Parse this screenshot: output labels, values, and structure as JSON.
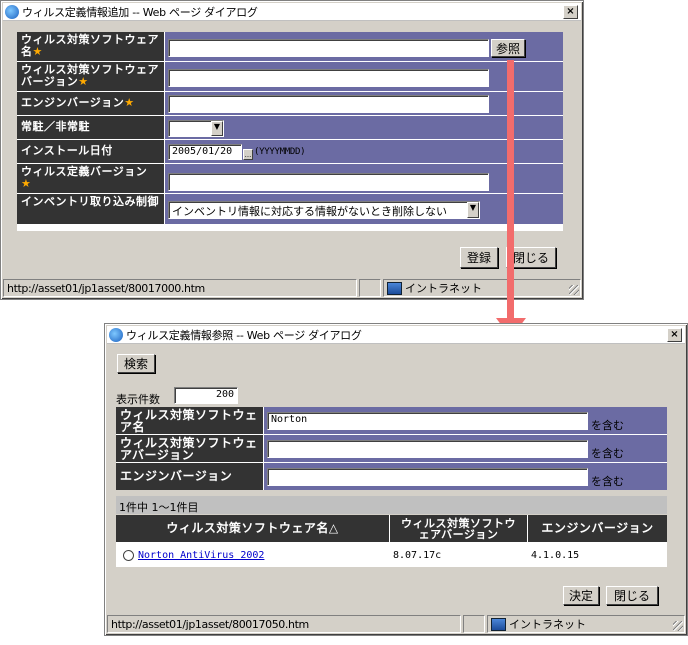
{
  "dialog1": {
    "title": "ウィルス定義情報追加 -- Web ページ ダイアログ",
    "close": "×",
    "fields": [
      {
        "label": "ウィルス対策ソフトウェア名",
        "required": true,
        "type": "text",
        "value": ""
      },
      {
        "label": "ウィルス対策ソフトウェアバージョン",
        "required": true,
        "type": "text",
        "value": ""
      },
      {
        "label": "エンジンバージョン",
        "required": true,
        "type": "text",
        "value": ""
      },
      {
        "label": "常駐／非常駐",
        "required": false,
        "type": "select",
        "value": ""
      },
      {
        "label": "インストール日付",
        "required": false,
        "type": "date",
        "value": "2005/01/20",
        "format": "(YYYYMMDD)"
      },
      {
        "label": "ウィルス定義バージョン",
        "required": true,
        "type": "text",
        "value": ""
      },
      {
        "label": "インベントリ取り込み制御",
        "required": false,
        "type": "select",
        "value": "インベントリ情報に対応する情報がないとき削除しない"
      }
    ],
    "browse_button": "参照",
    "star": "★",
    "register_button": "登録",
    "close_button": "閉じる",
    "status_url": "http://asset01/jp1asset/80017000.htm",
    "status_zone": "イントラネット"
  },
  "dialog2": {
    "title": "ウィルス定義情報参照 -- Web ページ ダイアログ",
    "close": "×",
    "search_button": "検索",
    "count_label": "表示件数",
    "count_value": "200",
    "filters": [
      {
        "label": "ウィルス対策ソフトウェア名",
        "value": "Norton",
        "suffix": "を含む"
      },
      {
        "label": "ウィルス対策ソフトウェアバージョン",
        "value": "",
        "suffix": "を含む"
      },
      {
        "label": "エンジンバージョン",
        "value": "",
        "suffix": "を含む"
      }
    ],
    "result_info": "1件中 1～1件目",
    "columns": [
      "ウィルス対策ソフトウェア名△",
      "ウィルス対策ソフトウェアバージョン",
      "エンジンバージョン"
    ],
    "rows": [
      {
        "name": "Norton AntiVirus 2002",
        "version": "8.07.17c",
        "engine": "4.1.0.15"
      }
    ],
    "decide_button": "決定",
    "close_button": "閉じる",
    "status_url": "http://asset01/jp1asset/80017050.htm",
    "status_zone": "イントラネット"
  }
}
